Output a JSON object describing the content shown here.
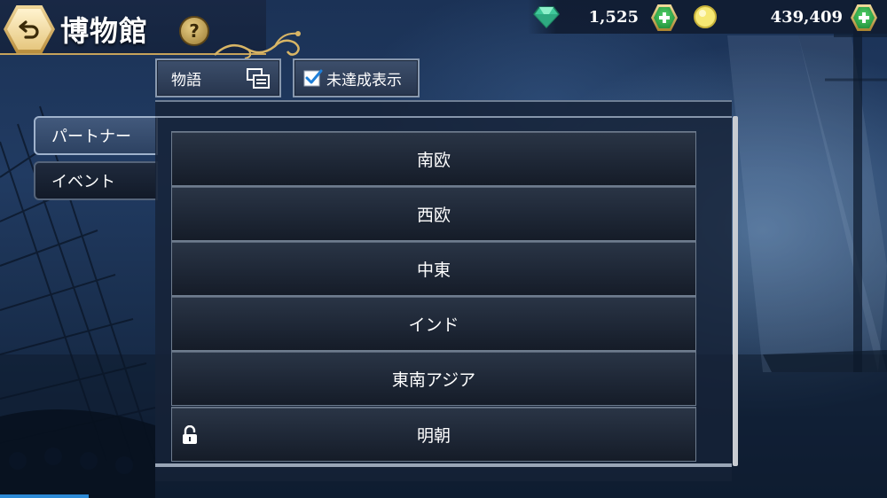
{
  "header": {
    "title": "博物館",
    "help_label": "?"
  },
  "currency": {
    "gems": "1,525",
    "coins": "439,409"
  },
  "toolbar": {
    "story_label": "物語",
    "unachieved_label": "未達成表示",
    "unachieved_checked": true
  },
  "side_tabs": [
    {
      "label": "パートナー",
      "active": true
    },
    {
      "label": "イベント",
      "active": false
    }
  ],
  "list": {
    "items": [
      {
        "label": "南欧",
        "locked": false
      },
      {
        "label": "西欧",
        "locked": false
      },
      {
        "label": "中東",
        "locked": false
      },
      {
        "label": "インド",
        "locked": false
      },
      {
        "label": "東南アジア",
        "locked": false
      },
      {
        "label": "明朝",
        "locked": true
      }
    ]
  },
  "colors": {
    "accent_gold": "#c7a35b",
    "plus_green": "#2aa84a",
    "gem_green": "#4fd7a0",
    "coin_yellow": "#f4e36a"
  }
}
